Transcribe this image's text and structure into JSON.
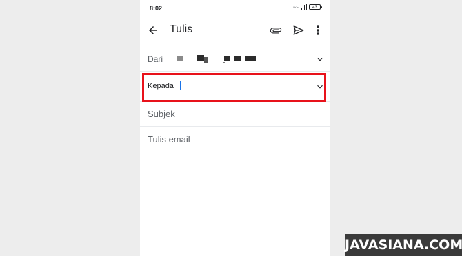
{
  "status_bar": {
    "time": "8:02",
    "net_speed": "0K/s",
    "battery": "43"
  },
  "app_bar": {
    "title": "Tulis",
    "back_icon": "arrow-back-icon",
    "attach_icon": "paperclip-icon",
    "send_icon": "send-icon",
    "more_icon": "more-vert-icon"
  },
  "compose": {
    "from_label": "Dari",
    "to_label": "Kepada",
    "subject_placeholder": "Subjek",
    "body_placeholder": "Tulis email"
  },
  "colors": {
    "highlight": "#e8121b",
    "cursor": "#1a73e8"
  },
  "watermark": "JAVASIANA.COM"
}
